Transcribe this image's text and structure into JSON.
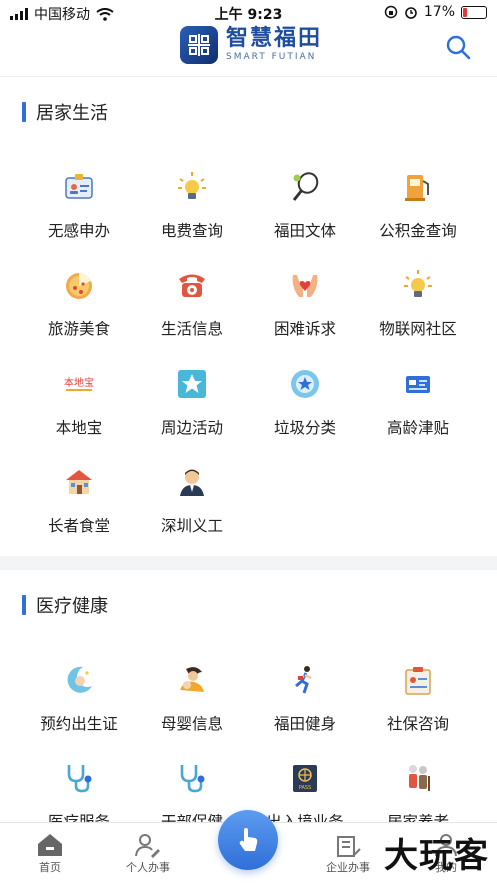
{
  "status": {
    "carrier": "中国移动",
    "time": "上午 9:23",
    "battery": "17%"
  },
  "header": {
    "title_cn": "智慧福田",
    "title_en": "SMART FUTIAN"
  },
  "sections": [
    {
      "title": "居家生活",
      "items": [
        {
          "label": "无感申办",
          "icon": "id-card-icon"
        },
        {
          "label": "电费查询",
          "icon": "lightbulb-icon"
        },
        {
          "label": "福田文体",
          "icon": "racket-icon"
        },
        {
          "label": "公积金查询",
          "icon": "fuel-pump-icon"
        },
        {
          "label": "旅游美食",
          "icon": "pizza-icon"
        },
        {
          "label": "生活信息",
          "icon": "telephone-icon"
        },
        {
          "label": "困难诉求",
          "icon": "hands-heart-icon"
        },
        {
          "label": "物联网社区",
          "icon": "lightbulb-icon"
        },
        {
          "label": "本地宝",
          "icon": "bendibao-logo-icon"
        },
        {
          "label": "周边活动",
          "icon": "star-icon"
        },
        {
          "label": "垃圾分类",
          "icon": "star-circle-icon"
        },
        {
          "label": "高龄津贴",
          "icon": "card-icon"
        },
        {
          "label": "长者食堂",
          "icon": "house-icon"
        },
        {
          "label": "深圳义工",
          "icon": "person-icon"
        }
      ]
    },
    {
      "title": "医疗健康",
      "items": [
        {
          "label": "预约出生证",
          "icon": "baby-moon-icon"
        },
        {
          "label": "母婴信息",
          "icon": "mother-baby-icon"
        },
        {
          "label": "福田健身",
          "icon": "runner-icon"
        },
        {
          "label": "社保咨询",
          "icon": "clipboard-icon"
        },
        {
          "label": "医疗服务",
          "icon": "stethoscope-icon"
        },
        {
          "label": "干部保健",
          "icon": "stethoscope-icon"
        },
        {
          "label": "出入境业务",
          "icon": "passport-icon"
        },
        {
          "label": "居家养老",
          "icon": "elderly-couple-icon"
        }
      ]
    }
  ],
  "nav": [
    {
      "label": "首页",
      "icon": "home-icon"
    },
    {
      "label": "个人办事",
      "icon": "person-edit-icon"
    },
    {
      "label": "企业办事",
      "icon": "building-icon"
    },
    {
      "label": "我的",
      "icon": "user-icon"
    }
  ],
  "passport_text": "PASS",
  "bendibao_text": "本地宝",
  "watermark": "大玩客"
}
